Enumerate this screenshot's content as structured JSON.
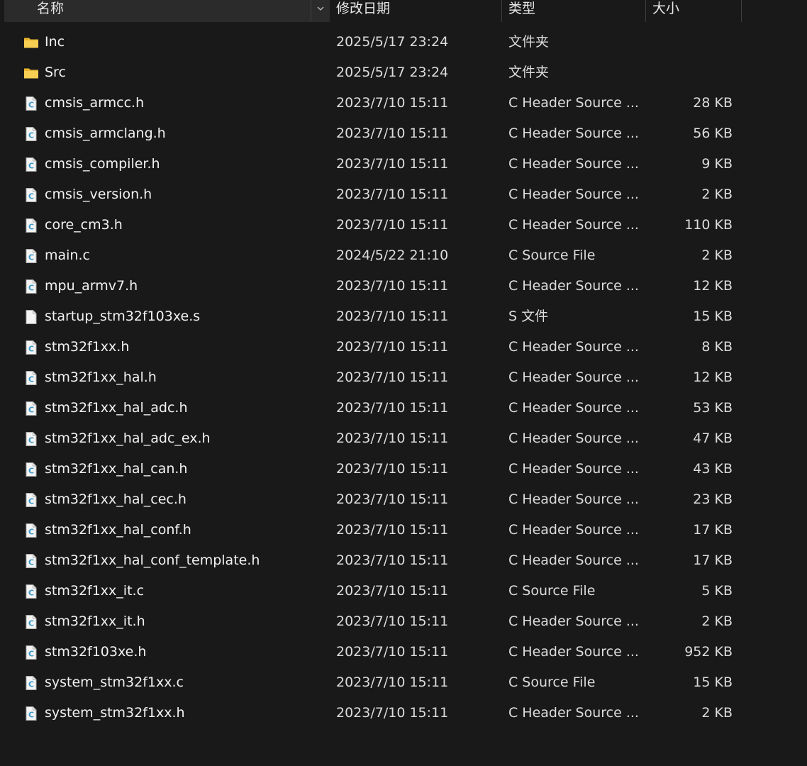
{
  "header": {
    "name": "名称",
    "date": "修改日期",
    "type": "类型",
    "size": "大小"
  },
  "files": [
    {
      "name": "Inc",
      "date": "2025/5/17 23:24",
      "type": "文件夹",
      "size": "",
      "icon": "folder-icon"
    },
    {
      "name": "Src",
      "date": "2025/5/17 23:24",
      "type": "文件夹",
      "size": "",
      "icon": "folder-icon"
    },
    {
      "name": "cmsis_armcc.h",
      "date": "2023/7/10 15:11",
      "type": "C Header Source ...",
      "size": "28 KB",
      "icon": "c-file-icon"
    },
    {
      "name": "cmsis_armclang.h",
      "date": "2023/7/10 15:11",
      "type": "C Header Source ...",
      "size": "56 KB",
      "icon": "c-file-icon"
    },
    {
      "name": "cmsis_compiler.h",
      "date": "2023/7/10 15:11",
      "type": "C Header Source ...",
      "size": "9 KB",
      "icon": "c-file-icon"
    },
    {
      "name": "cmsis_version.h",
      "date": "2023/7/10 15:11",
      "type": "C Header Source ...",
      "size": "2 KB",
      "icon": "c-file-icon"
    },
    {
      "name": "core_cm3.h",
      "date": "2023/7/10 15:11",
      "type": "C Header Source ...",
      "size": "110 KB",
      "icon": "c-file-icon"
    },
    {
      "name": "main.c",
      "date": "2024/5/22 21:10",
      "type": "C Source File",
      "size": "2 KB",
      "icon": "c-file-icon"
    },
    {
      "name": "mpu_armv7.h",
      "date": "2023/7/10 15:11",
      "type": "C Header Source ...",
      "size": "12 KB",
      "icon": "c-file-icon"
    },
    {
      "name": "startup_stm32f103xe.s",
      "date": "2023/7/10 15:11",
      "type": "S 文件",
      "size": "15 KB",
      "icon": "blank-file-icon"
    },
    {
      "name": "stm32f1xx.h",
      "date": "2023/7/10 15:11",
      "type": "C Header Source ...",
      "size": "8 KB",
      "icon": "c-file-icon"
    },
    {
      "name": "stm32f1xx_hal.h",
      "date": "2023/7/10 15:11",
      "type": "C Header Source ...",
      "size": "12 KB",
      "icon": "c-file-icon"
    },
    {
      "name": "stm32f1xx_hal_adc.h",
      "date": "2023/7/10 15:11",
      "type": "C Header Source ...",
      "size": "53 KB",
      "icon": "c-file-icon"
    },
    {
      "name": "stm32f1xx_hal_adc_ex.h",
      "date": "2023/7/10 15:11",
      "type": "C Header Source ...",
      "size": "47 KB",
      "icon": "c-file-icon"
    },
    {
      "name": "stm32f1xx_hal_can.h",
      "date": "2023/7/10 15:11",
      "type": "C Header Source ...",
      "size": "43 KB",
      "icon": "c-file-icon"
    },
    {
      "name": "stm32f1xx_hal_cec.h",
      "date": "2023/7/10 15:11",
      "type": "C Header Source ...",
      "size": "23 KB",
      "icon": "c-file-icon"
    },
    {
      "name": "stm32f1xx_hal_conf.h",
      "date": "2023/7/10 15:11",
      "type": "C Header Source ...",
      "size": "17 KB",
      "icon": "c-file-icon"
    },
    {
      "name": "stm32f1xx_hal_conf_template.h",
      "date": "2023/7/10 15:11",
      "type": "C Header Source ...",
      "size": "17 KB",
      "icon": "c-file-icon"
    },
    {
      "name": "stm32f1xx_it.c",
      "date": "2023/7/10 15:11",
      "type": "C Source File",
      "size": "5 KB",
      "icon": "c-file-icon"
    },
    {
      "name": "stm32f1xx_it.h",
      "date": "2023/7/10 15:11",
      "type": "C Header Source ...",
      "size": "2 KB",
      "icon": "c-file-icon"
    },
    {
      "name": "stm32f103xe.h",
      "date": "2023/7/10 15:11",
      "type": "C Header Source ...",
      "size": "952 KB",
      "icon": "c-file-icon"
    },
    {
      "name": "system_stm32f1xx.c",
      "date": "2023/7/10 15:11",
      "type": "C Source File",
      "size": "15 KB",
      "icon": "c-file-icon"
    },
    {
      "name": "system_stm32f1xx.h",
      "date": "2023/7/10 15:11",
      "type": "C Header Source ...",
      "size": "2 KB",
      "icon": "c-file-icon"
    }
  ],
  "colors": {
    "background": "#191919",
    "header_active": "#2b2b2b",
    "folder": "#f4c542",
    "c_accent": "#3a98c8"
  }
}
